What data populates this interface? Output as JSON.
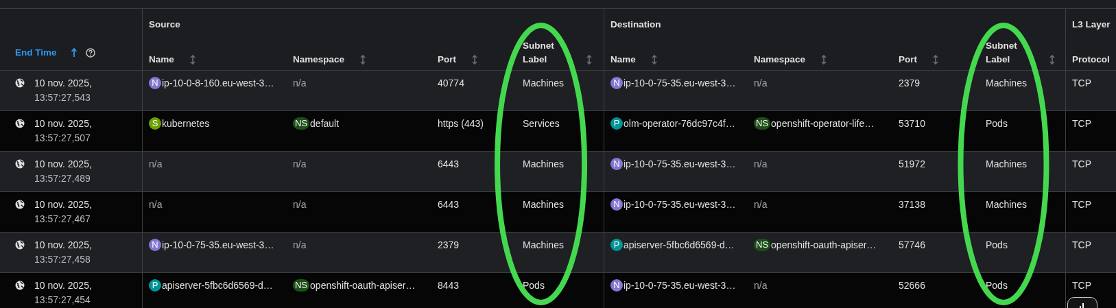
{
  "end_time_column": {
    "label": "End Time",
    "sorted": true
  },
  "groups": [
    {
      "label": "Source",
      "columns": [
        {
          "label": "Name",
          "sortable": true,
          "circled": false
        },
        {
          "label": "Namespace",
          "sortable": true,
          "circled": false
        },
        {
          "label": "Port",
          "sortable": true,
          "circled": false
        },
        {
          "label": "Subnet Label",
          "sortable": true,
          "circled": true
        }
      ]
    },
    {
      "label": "Destination",
      "columns": [
        {
          "label": "Name",
          "sortable": true,
          "circled": false
        },
        {
          "label": "Namespace",
          "sortable": true,
          "circled": false
        },
        {
          "label": "Port",
          "sortable": true,
          "circled": false
        },
        {
          "label": "Subnet Label",
          "sortable": true,
          "circled": true
        }
      ]
    },
    {
      "label": "L3 Layer",
      "columns": [
        {
          "label": "Protocol",
          "sortable": false,
          "circled": false
        }
      ]
    }
  ],
  "rows": [
    {
      "date": "10 nov. 2025,",
      "time": "13:57:27,543",
      "cells": [
        [
          {
            "badge": "N",
            "color": "#8476d1",
            "text": "ip-10-0-8-160.eu-west-3…"
          },
          {
            "text": "n/a",
            "muted": true
          },
          {
            "text": "40774"
          },
          {
            "text": "Machines"
          }
        ],
        [
          {
            "badge": "N",
            "color": "#8476d1",
            "text": "ip-10-0-75-35.eu-west-3…"
          },
          {
            "text": "n/a",
            "muted": true
          },
          {
            "text": "2379"
          },
          {
            "text": "Machines"
          }
        ],
        [
          {
            "text": "TCP"
          }
        ]
      ]
    },
    {
      "date": "10 nov. 2025,",
      "time": "13:57:27,507",
      "cells": [
        [
          {
            "badge": "S",
            "color": "#6ca100",
            "text": "kubernetes"
          },
          {
            "badge": "NS",
            "color": "#1e4f18",
            "text": "default"
          },
          {
            "text": "https (443)"
          },
          {
            "text": "Services"
          }
        ],
        [
          {
            "badge": "P",
            "color": "#009596",
            "text": "olm-operator-76dc97c4f…"
          },
          {
            "badge": "NS",
            "color": "#1e4f18",
            "text": "openshift-operator-life…"
          },
          {
            "text": "53710"
          },
          {
            "text": "Pods"
          }
        ],
        [
          {
            "text": "TCP"
          }
        ]
      ]
    },
    {
      "date": "10 nov. 2025,",
      "time": "13:57:27,489",
      "cells": [
        [
          {
            "text": "n/a",
            "muted": true
          },
          {
            "text": "n/a",
            "muted": true
          },
          {
            "text": "6443"
          },
          {
            "text": "Machines"
          }
        ],
        [
          {
            "badge": "N",
            "color": "#8476d1",
            "text": "ip-10-0-75-35.eu-west-3…"
          },
          {
            "text": "n/a",
            "muted": true
          },
          {
            "text": "51972"
          },
          {
            "text": "Machines"
          }
        ],
        [
          {
            "text": "TCP"
          }
        ]
      ]
    },
    {
      "date": "10 nov. 2025,",
      "time": "13:57:27,467",
      "cells": [
        [
          {
            "text": "n/a",
            "muted": true
          },
          {
            "text": "n/a",
            "muted": true
          },
          {
            "text": "6443"
          },
          {
            "text": "Machines"
          }
        ],
        [
          {
            "badge": "N",
            "color": "#8476d1",
            "text": "ip-10-0-75-35.eu-west-3…"
          },
          {
            "text": "n/a",
            "muted": true
          },
          {
            "text": "37138"
          },
          {
            "text": "Machines"
          }
        ],
        [
          {
            "text": "TCP"
          }
        ]
      ]
    },
    {
      "date": "10 nov. 2025,",
      "time": "13:57:27,458",
      "cells": [
        [
          {
            "badge": "N",
            "color": "#8476d1",
            "text": "ip-10-0-75-35.eu-west-3…"
          },
          {
            "text": "n/a",
            "muted": true
          },
          {
            "text": "2379"
          },
          {
            "text": "Machines"
          }
        ],
        [
          {
            "badge": "P",
            "color": "#009596",
            "text": "apiserver-5fbc6d6569-d…"
          },
          {
            "badge": "NS",
            "color": "#1e4f18",
            "text": "openshift-oauth-apiser…"
          },
          {
            "text": "57746"
          },
          {
            "text": "Pods"
          }
        ],
        [
          {
            "text": "TCP"
          }
        ]
      ]
    },
    {
      "date": "10 nov. 2025,",
      "time": "13:57:27,454",
      "cells": [
        [
          {
            "badge": "P",
            "color": "#009596",
            "text": "apiserver-5fbc6d6569-d…"
          },
          {
            "badge": "NS",
            "color": "#1e4f18",
            "text": "openshift-oauth-apiser…"
          },
          {
            "text": "8443"
          },
          {
            "text": "Pods"
          }
        ],
        [
          {
            "badge": "N",
            "color": "#8476d1",
            "text": "ip-10-0-75-35.eu-west-3…"
          },
          {
            "text": "n/a",
            "muted": true
          },
          {
            "text": "52666"
          },
          {
            "text": "Pods"
          }
        ],
        [
          {
            "text": "TCP"
          }
        ]
      ]
    }
  ]
}
